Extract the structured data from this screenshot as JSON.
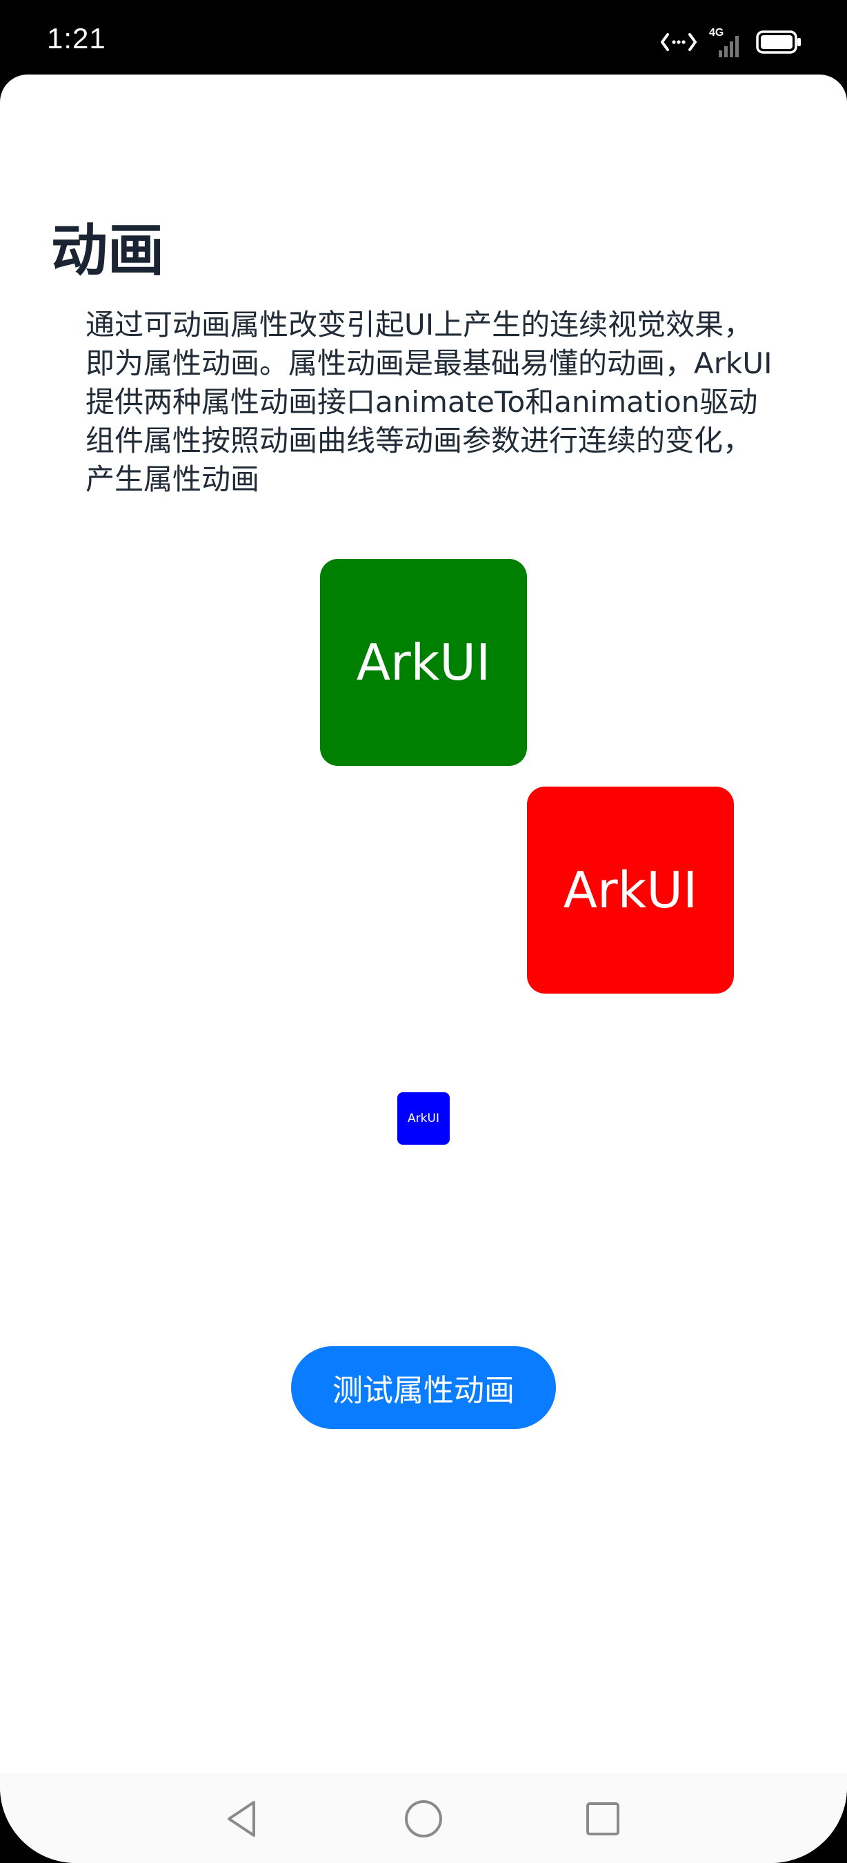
{
  "status_bar": {
    "time": "1:21",
    "network_label": "4G",
    "icons": [
      "data-transfer-icon",
      "signal-icon",
      "battery-icon"
    ]
  },
  "page": {
    "title": "动画",
    "description": "通过可动画属性改变引起UI上产生的连续视觉效果，即为属性动画。属性动画是最基础易懂的动画，ArkUI提供两种属性动画接口animateTo和animation驱动组件属性按照动画曲线等动画参数进行连续的变化，产生属性动画"
  },
  "boxes": {
    "green": {
      "label": "ArkUI",
      "color": "#008000"
    },
    "red": {
      "label": "ArkUI",
      "color": "#ff0000"
    },
    "blue": {
      "label": "ArkUI",
      "color": "#0000ff"
    }
  },
  "button": {
    "label": "测试属性动画",
    "color": "#0a7cff"
  },
  "nav_bar": {
    "icons": [
      "back-icon",
      "home-icon",
      "recents-icon"
    ]
  }
}
